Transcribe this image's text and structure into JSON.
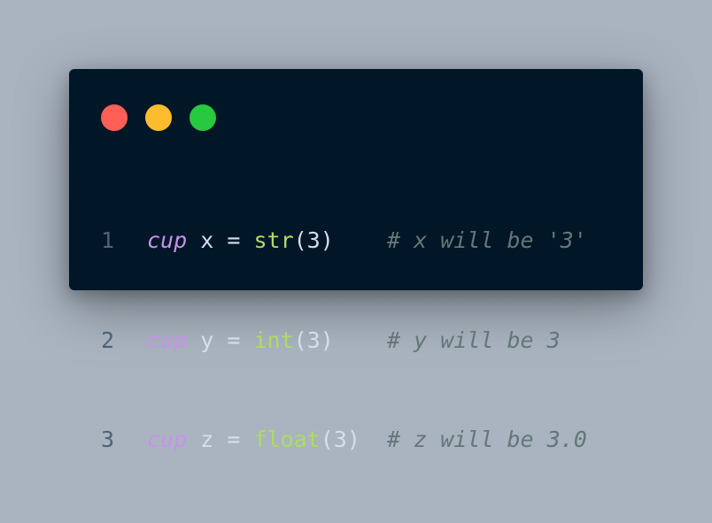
{
  "window": {
    "dots": [
      {
        "name": "close",
        "color": "#ff5f56"
      },
      {
        "name": "minimize",
        "color": "#ffbd2e"
      },
      {
        "name": "maximize",
        "color": "#27c93f"
      }
    ]
  },
  "code": {
    "lines": [
      {
        "number": "1",
        "keyword": "cup",
        "var": "x",
        "op": "=",
        "func": "str",
        "args": "(3)",
        "pad": "    ",
        "comment": "# x will be '3'"
      },
      {
        "number": "2",
        "keyword": "cup",
        "var": "y",
        "op": "=",
        "func": "int",
        "args": "(3)",
        "pad": "    ",
        "comment": "# y will be 3"
      },
      {
        "number": "3",
        "keyword": "cup",
        "var": "z",
        "op": "=",
        "func": "float",
        "args": "(3)",
        "pad": "  ",
        "comment": "# z will be 3.0"
      }
    ]
  },
  "colors": {
    "background": "#011627",
    "keyword": "#c792ea",
    "function": "#addb67",
    "comment": "#637777",
    "text": "#d6deeb",
    "line_number": "#4b6479"
  }
}
